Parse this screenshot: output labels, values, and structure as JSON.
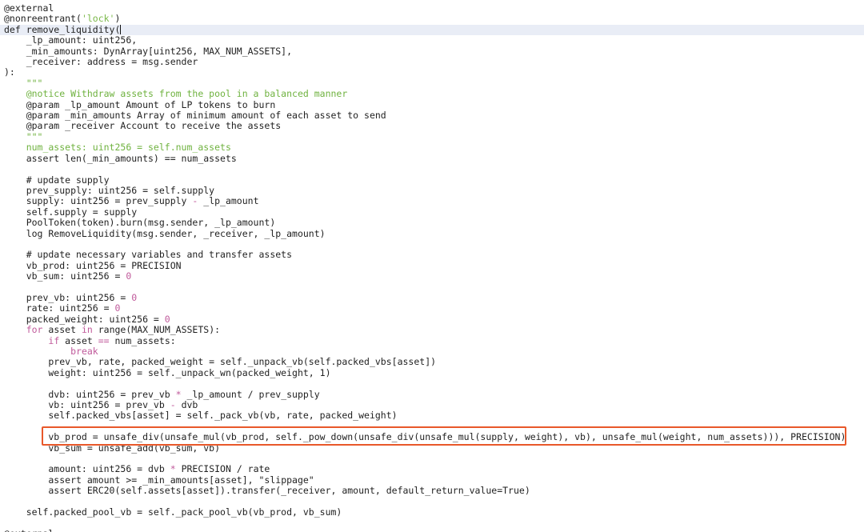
{
  "colors": {
    "highlight_border": "#e8582a",
    "active_line_bg": "#e9edf6",
    "keyword": "#c05a9b",
    "string": "#7bb84a",
    "docstring": "#6fb23f"
  },
  "code": {
    "active_line_index": 2,
    "highlighted_line_index": 40,
    "lines": [
      [
        {
          "t": "@external",
          "c": "plain"
        }
      ],
      [
        {
          "t": "@nonreentrant(",
          "c": "plain"
        },
        {
          "t": "'lock'",
          "c": "str"
        },
        {
          "t": ")",
          "c": "plain"
        }
      ],
      [
        {
          "t": "def remove_liquidity(",
          "c": "plain"
        }
      ],
      [
        {
          "t": "    _lp_amount: uint256,",
          "c": "plain"
        }
      ],
      [
        {
          "t": "    _min_amounts: DynArray[uint256, MAX_NUM_ASSETS],",
          "c": "plain"
        }
      ],
      [
        {
          "t": "    _receiver: address = msg.sender",
          "c": "plain"
        }
      ],
      [
        {
          "t": "):",
          "c": "plain"
        }
      ],
      [
        {
          "t": "    \"\"\"",
          "c": "doc"
        }
      ],
      [
        {
          "t": "    @notice Withdraw assets from the pool in a balanced manner",
          "c": "doc"
        }
      ],
      [
        {
          "t": "    @param _lp_amount Amount of LP tokens to burn",
          "c": "plain"
        }
      ],
      [
        {
          "t": "    @param _min_amounts Array of minimum amount of each asset to send",
          "c": "plain"
        }
      ],
      [
        {
          "t": "    @param _receiver Account to receive the assets",
          "c": "plain"
        }
      ],
      [
        {
          "t": "    \"\"\"",
          "c": "doc"
        }
      ],
      [
        {
          "t": "    num_assets: uint256 = self.num_assets",
          "c": "doc"
        }
      ],
      [
        {
          "t": "    assert len(_min_amounts) == num_assets",
          "c": "plain"
        }
      ],
      [
        {
          "t": "",
          "c": "plain"
        }
      ],
      [
        {
          "t": "    # update supply",
          "c": "plain"
        }
      ],
      [
        {
          "t": "    prev_supply: uint256 = self.supply",
          "c": "plain"
        }
      ],
      [
        {
          "t": "    supply: uint256 = prev_supply ",
          "c": "plain"
        },
        {
          "t": "-",
          "c": "op"
        },
        {
          "t": " _lp_amount",
          "c": "plain"
        }
      ],
      [
        {
          "t": "    self.supply = supply",
          "c": "plain"
        }
      ],
      [
        {
          "t": "    PoolToken(token).burn(msg.sender, _lp_amount)",
          "c": "plain"
        }
      ],
      [
        {
          "t": "    log RemoveLiquidity(msg.sender, _receiver, _lp_amount)",
          "c": "plain"
        }
      ],
      [
        {
          "t": "",
          "c": "plain"
        }
      ],
      [
        {
          "t": "    # update necessary variables and transfer assets",
          "c": "plain"
        }
      ],
      [
        {
          "t": "    vb_prod: uint256 = PRECISION",
          "c": "plain"
        }
      ],
      [
        {
          "t": "    vb_sum: uint256 = ",
          "c": "plain"
        },
        {
          "t": "0",
          "c": "num"
        }
      ],
      [
        {
          "t": "",
          "c": "plain"
        }
      ],
      [
        {
          "t": "    prev_vb: uint256 = ",
          "c": "plain"
        },
        {
          "t": "0",
          "c": "num"
        }
      ],
      [
        {
          "t": "    rate: uint256 = ",
          "c": "plain"
        },
        {
          "t": "0",
          "c": "num"
        }
      ],
      [
        {
          "t": "    packed_weight: uint256 = ",
          "c": "plain"
        },
        {
          "t": "0",
          "c": "num"
        }
      ],
      [
        {
          "t": "    ",
          "c": "plain"
        },
        {
          "t": "for",
          "c": "kw"
        },
        {
          "t": " asset ",
          "c": "plain"
        },
        {
          "t": "in",
          "c": "kw"
        },
        {
          "t": " range(MAX_NUM_ASSETS):",
          "c": "plain"
        }
      ],
      [
        {
          "t": "        ",
          "c": "plain"
        },
        {
          "t": "if",
          "c": "kw"
        },
        {
          "t": " asset ",
          "c": "plain"
        },
        {
          "t": "==",
          "c": "op"
        },
        {
          "t": " num_assets:",
          "c": "plain"
        }
      ],
      [
        {
          "t": "            ",
          "c": "plain"
        },
        {
          "t": "break",
          "c": "kw"
        }
      ],
      [
        {
          "t": "        prev_vb, rate, packed_weight = self._unpack_vb(self.packed_vbs[asset])",
          "c": "plain"
        }
      ],
      [
        {
          "t": "        weight: uint256 = self._unpack_wn(packed_weight, 1)",
          "c": "plain"
        }
      ],
      [
        {
          "t": "",
          "c": "plain"
        }
      ],
      [
        {
          "t": "        dvb: uint256 = prev_vb ",
          "c": "plain"
        },
        {
          "t": "*",
          "c": "op"
        },
        {
          "t": " _lp_amount / prev_supply",
          "c": "plain"
        }
      ],
      [
        {
          "t": "        vb: uint256 = prev_vb ",
          "c": "plain"
        },
        {
          "t": "-",
          "c": "op"
        },
        {
          "t": " dvb",
          "c": "plain"
        }
      ],
      [
        {
          "t": "        self.packed_vbs[asset] = self._pack_vb(vb, rate, packed_weight)",
          "c": "plain"
        }
      ],
      [
        {
          "t": "",
          "c": "plain"
        }
      ],
      [
        {
          "t": "        vb_prod = unsafe_div(unsafe_mul(vb_prod, self._pow_down(unsafe_div(unsafe_mul(supply, weight), vb), unsafe_mul(weight, num_assets))), PRECISION)",
          "c": "plain"
        }
      ],
      [
        {
          "t": "        vb_sum = unsafe_add(vb_sum, vb)",
          "c": "plain"
        }
      ],
      [
        {
          "t": "",
          "c": "plain"
        }
      ],
      [
        {
          "t": "        amount: uint256 = dvb ",
          "c": "plain"
        },
        {
          "t": "*",
          "c": "op"
        },
        {
          "t": " PRECISION / rate",
          "c": "plain"
        }
      ],
      [
        {
          "t": "        assert amount >= _min_amounts[asset], ",
          "c": "plain"
        },
        {
          "t": "\"slippage\"",
          "c": "plain"
        }
      ],
      [
        {
          "t": "        assert ERC20(self.assets[asset]).transfer(_receiver, amount, default_return_value=True)",
          "c": "plain"
        }
      ],
      [
        {
          "t": "",
          "c": "plain"
        }
      ],
      [
        {
          "t": "    self.packed_pool_vb = self._pack_pool_vb(vb_prod, vb_sum)",
          "c": "plain"
        }
      ],
      [
        {
          "t": "",
          "c": "plain"
        }
      ],
      [
        {
          "t": "@external",
          "c": "plain"
        }
      ]
    ]
  }
}
